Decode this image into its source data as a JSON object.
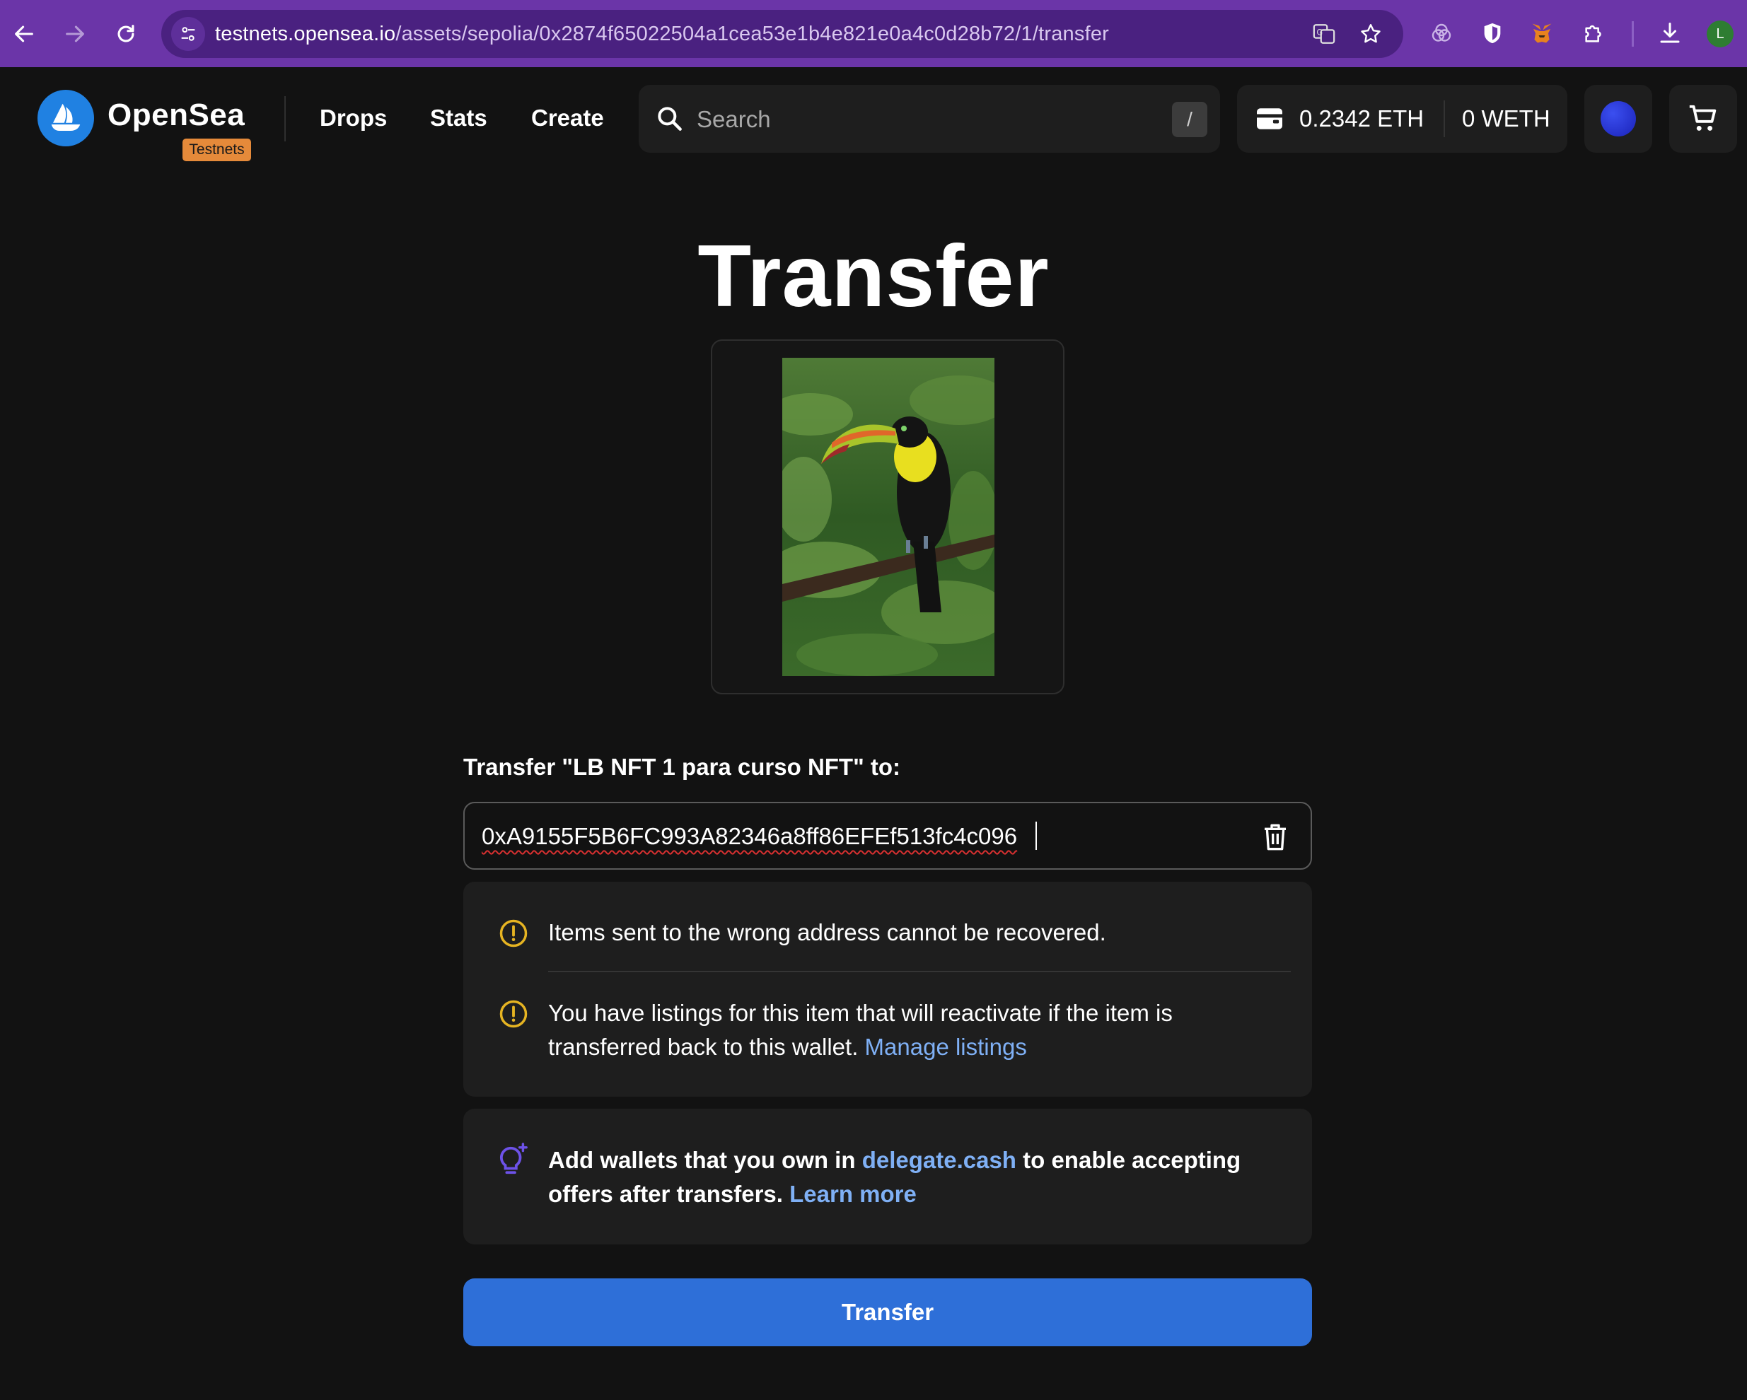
{
  "browser": {
    "url_host": "testnets.opensea.io",
    "url_path": "/assets/sepolia/0x2874f65022504a1cea53e1b4e821e0a4c0d28b72/1/transfer",
    "profile_initial": "L",
    "toolbar_icons": [
      "back-icon",
      "forward-icon",
      "reload-icon",
      "site-settings-icon",
      "translate-icon",
      "bookmark-star-icon",
      "extension-icon",
      "shield-icon",
      "metamask-icon",
      "puzzle-icon",
      "download-icon"
    ],
    "accent": "#6b35a8"
  },
  "header": {
    "brand": "OpenSea",
    "badge": "Testnets",
    "nav": [
      "Drops",
      "Stats",
      "Create"
    ],
    "search_placeholder": "Search",
    "search_shortcut": "/",
    "eth_balance": "0.2342 ETH",
    "weth_balance": "0 WETH",
    "brand_color": "#2081e2"
  },
  "main": {
    "title": "Transfer",
    "transfer_label": "Transfer \"LB NFT 1 para curso NFT\" to:",
    "address_value": "0xA9155F5B6FC993A82346a8ff86EFEf513fc4c096",
    "warning_1": "Items sent to the wrong address cannot be recovered.",
    "warning_2_line1": "You have listings for this item that will reactivate if the item is",
    "warning_2_line2": "transferred back to this wallet.",
    "manage_listings": "Manage listings",
    "info_part1": "Add wallets that you own in",
    "info_link": "delegate.cash",
    "info_part2": "to enable accepting",
    "info_line2": "offers after transfers.",
    "learn_more": "Learn more",
    "transfer_button": "Transfer",
    "button_color": "#2e6fd8",
    "warning_color": "#e6b422",
    "link_color": "#7fb0f5"
  }
}
